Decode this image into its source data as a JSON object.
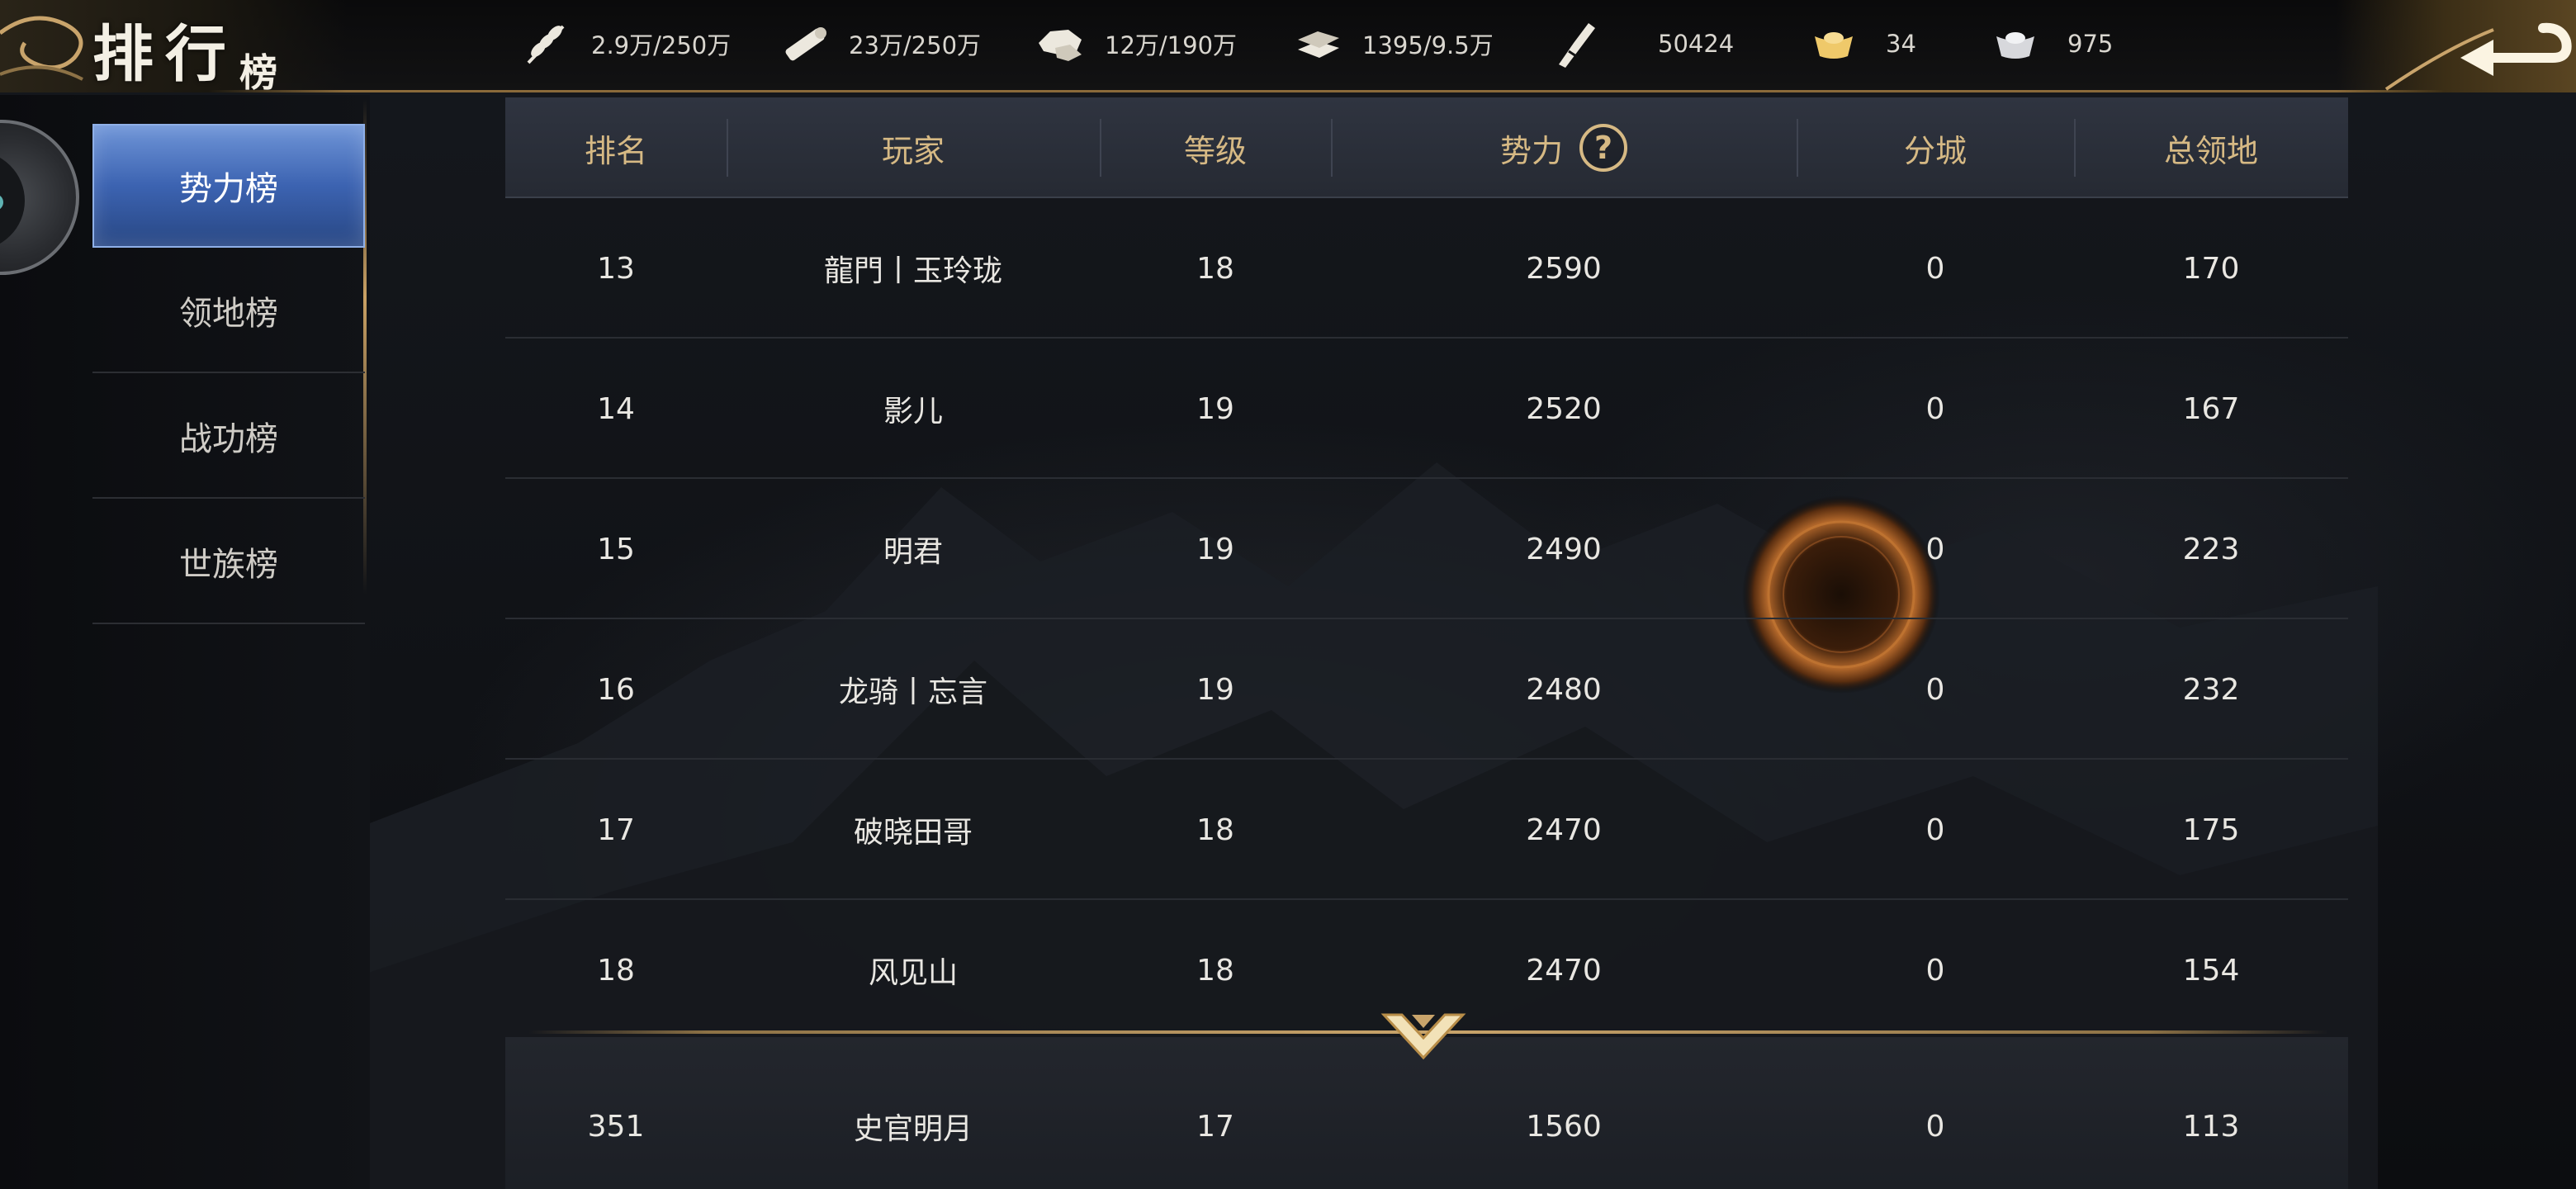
{
  "title": {
    "main": "排行",
    "sub": "榜"
  },
  "resources": [
    {
      "icon": "grain-icon",
      "value": "2.9万/250万"
    },
    {
      "icon": "wood-icon",
      "value": "23万/250万"
    },
    {
      "icon": "stone-icon",
      "value": "12万/190万"
    },
    {
      "icon": "iron-icon",
      "value": "1395/9.5万"
    },
    {
      "icon": "copper-coin-icon",
      "value": "50424"
    },
    {
      "icon": "gold-ingot-icon",
      "value": "34"
    },
    {
      "icon": "silver-ingot-icon",
      "value": "975"
    }
  ],
  "sidebar": {
    "items": [
      {
        "label": "势力榜",
        "active": true
      },
      {
        "label": "领地榜",
        "active": false
      },
      {
        "label": "战功榜",
        "active": false
      },
      {
        "label": "世族榜",
        "active": false
      }
    ]
  },
  "table": {
    "headers": {
      "rank": "排名",
      "player": "玩家",
      "level": "等级",
      "power": "势力",
      "branch": "分城",
      "territory": "总领地"
    },
    "help_icon_glyph": "?",
    "rows": [
      {
        "rank": "13",
        "player": "龍門丨玉玲珑",
        "level": "18",
        "power": "2590",
        "branch": "0",
        "territory": "170"
      },
      {
        "rank": "14",
        "player": "影儿",
        "level": "19",
        "power": "2520",
        "branch": "0",
        "territory": "167"
      },
      {
        "rank": "15",
        "player": "明君",
        "level": "19",
        "power": "2490",
        "branch": "0",
        "territory": "223"
      },
      {
        "rank": "16",
        "player": "龙骑丨忘言",
        "level": "19",
        "power": "2480",
        "branch": "0",
        "territory": "232"
      },
      {
        "rank": "17",
        "player": "破晓田哥",
        "level": "18",
        "power": "2470",
        "branch": "0",
        "territory": "175"
      },
      {
        "rank": "18",
        "player": "风见山",
        "level": "18",
        "power": "2470",
        "branch": "0",
        "territory": "154"
      }
    ],
    "self_row": {
      "rank": "351",
      "player": "史官明月",
      "level": "17",
      "power": "1560",
      "branch": "0",
      "territory": "113"
    }
  },
  "colors": {
    "header_text": "#d6b984",
    "active_tab": "#3c63b1",
    "gold_accent": "#c9a46b"
  }
}
